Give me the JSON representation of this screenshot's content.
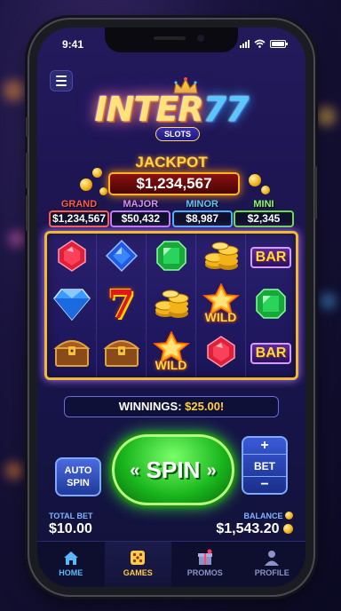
{
  "status": {
    "time": "9:41"
  },
  "logo": {
    "title_a": "INTER",
    "title_b": "77",
    "subtitle": "SLOTS"
  },
  "jackpot": {
    "label": "JACKPOT",
    "value": "$1,234,567"
  },
  "tiers": [
    {
      "label": "GRAND",
      "value": "$1,234,567",
      "color": "#ff5a4a"
    },
    {
      "label": "MAJOR",
      "value": "$50,432",
      "color": "#d88cff"
    },
    {
      "label": "MINOR",
      "value": "$8,987",
      "color": "#5ac8ff"
    },
    {
      "label": "MINI",
      "value": "$2,345",
      "color": "#8aff6a"
    }
  ],
  "reels": [
    [
      "ruby",
      "sapphire",
      "emerald",
      "coins",
      "bar"
    ],
    [
      "diamond",
      "seven",
      "coins",
      "wild",
      "emerald"
    ],
    [
      "chest",
      "chest",
      "wild",
      "ruby",
      "bar"
    ]
  ],
  "symbols": {
    "bar": "BAR",
    "wild": "WILD",
    "seven": "7"
  },
  "winnings": {
    "label": "WINNINGS:",
    "amount": "$25.00!"
  },
  "controls": {
    "auto_line1": "AUTO",
    "auto_line2": "SPIN",
    "spin": "SPIN",
    "bet_plus": "+",
    "bet_label": "BET",
    "bet_minus": "−"
  },
  "footer": {
    "total_bet_label": "TOTAL BET",
    "total_bet": "$10.00",
    "balance_label": "BALANCE",
    "balance": "$1,543.20"
  },
  "tabs": [
    {
      "label": "HOME",
      "icon": "home-icon"
    },
    {
      "label": "GAMES",
      "icon": "dice-icon"
    },
    {
      "label": "PROMOS",
      "icon": "gift-icon"
    },
    {
      "label": "PROFILE",
      "icon": "user-icon"
    }
  ]
}
